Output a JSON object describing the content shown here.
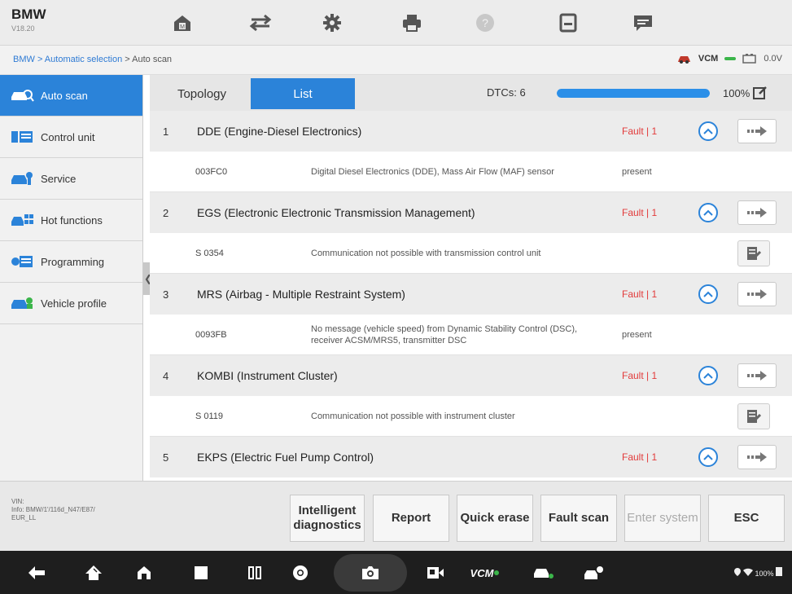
{
  "header": {
    "brand": "BMW",
    "version": "V18.20"
  },
  "toolbar": [
    {
      "name": "home"
    },
    {
      "name": "vehicle-swap"
    },
    {
      "name": "settings"
    },
    {
      "name": "print"
    },
    {
      "name": "help"
    },
    {
      "name": "save"
    },
    {
      "name": "message"
    }
  ],
  "breadcrumb": {
    "link": "BMW > Automatic selection",
    "current": " > Auto scan"
  },
  "status": {
    "vcm": "VCM",
    "voltage": "0.0V"
  },
  "sidebar": {
    "items": [
      {
        "label": "Auto scan"
      },
      {
        "label": "Control unit"
      },
      {
        "label": "Service"
      },
      {
        "label": "Hot functions"
      },
      {
        "label": "Programming"
      },
      {
        "label": "Vehicle profile"
      }
    ]
  },
  "tabs": {
    "topology": "Topology",
    "list": "List"
  },
  "dtcs": "DTCs: 6",
  "progress": {
    "value": 100,
    "label": "100%"
  },
  "systems": [
    {
      "num": "1",
      "name": "DDE (Engine-Diesel Electronics)",
      "fault": "Fault | 1"
    },
    {
      "num": "2",
      "name": "EGS (Electronic Electronic Transmission Management)",
      "fault": "Fault | 1"
    },
    {
      "num": "3",
      "name": "MRS (Airbag - Multiple Restraint System)",
      "fault": "Fault | 1"
    },
    {
      "num": "4",
      "name": "KOMBI (Instrument Cluster)",
      "fault": "Fault | 1"
    },
    {
      "num": "5",
      "name": "EKPS (Electric Fuel Pump Control)",
      "fault": "Fault | 1"
    }
  ],
  "faults": [
    {
      "code": "003FC0",
      "desc": "Digital Diesel Electronics (DDE), Mass Air Flow (MAF) sensor",
      "status": "present"
    },
    {
      "code": "S 0354",
      "desc": "Communication not possible with transmission control unit",
      "status": ""
    },
    {
      "code": "0093FB",
      "desc": "No message (vehicle speed) from Dynamic Stability Control (DSC), receiver ACSM/MRS5, transmitter DSC",
      "status": "present"
    },
    {
      "code": "S 0119",
      "desc": "Communication not possible with instrument cluster",
      "status": ""
    }
  ],
  "vin": {
    "l1": "VIN:",
    "l2": "Info: BMW/1'/116d_N47/E87/",
    "l3": "EUR_LL"
  },
  "buttons": {
    "intelligent": "Intelligent diagnostics",
    "report": "Report",
    "quick": "Quick erase",
    "fault": "Fault scan",
    "enter": "Enter system",
    "esc": "ESC"
  },
  "navbar": {
    "vcm": "VCM",
    "status": "100%"
  }
}
